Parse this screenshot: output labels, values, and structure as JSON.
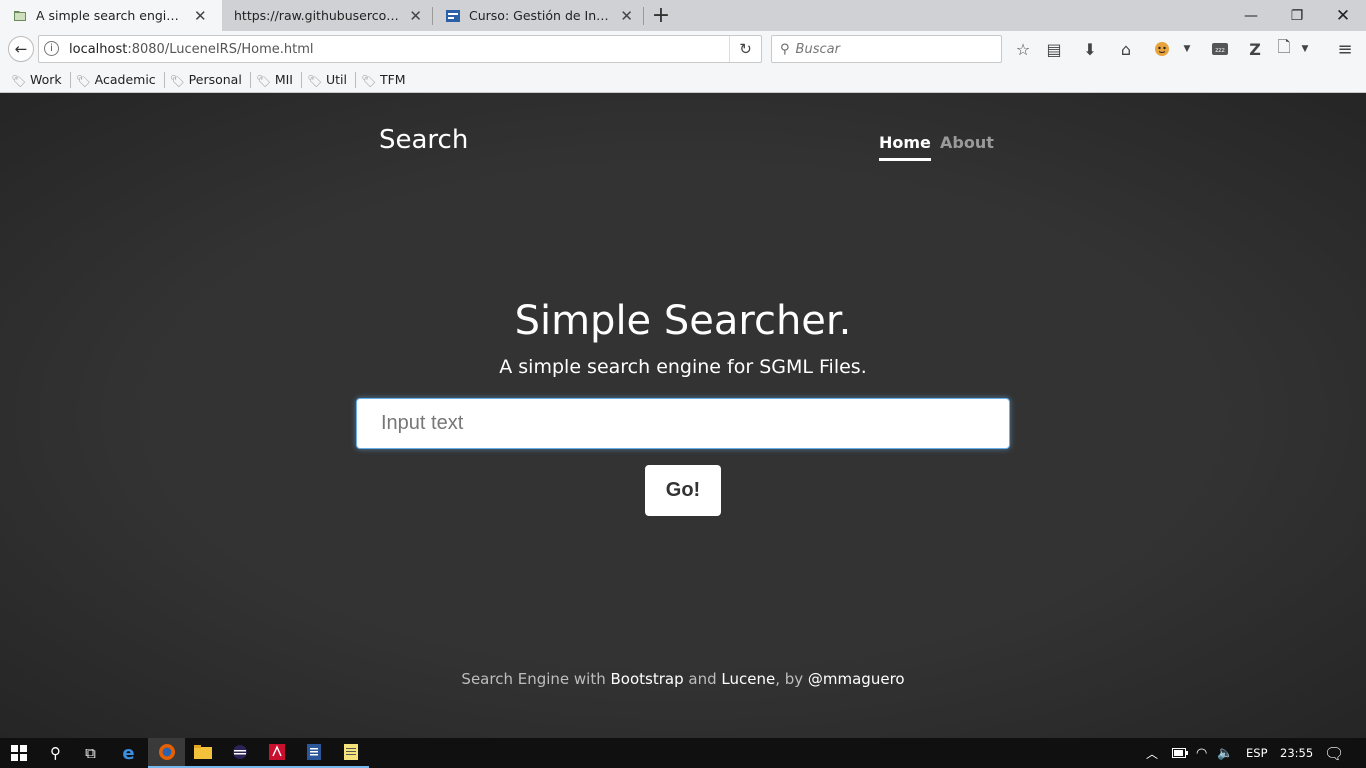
{
  "browser": {
    "tabs": [
      {
        "title": "A simple search engine with",
        "icon": "book-icon"
      },
      {
        "title": "https://raw.githubusercontent.c",
        "icon": ""
      },
      {
        "title": "Curso: Gestión de Informaci",
        "icon": "moodle-icon"
      }
    ],
    "url_host": "localhost",
    "url_rest": ":8080/LuceneIRS/Home.html",
    "search_placeholder": "Buscar",
    "bookmarks": [
      "Work",
      "Academic",
      "Personal",
      "MII",
      "Util",
      "TFM"
    ]
  },
  "site": {
    "brand": "Search",
    "nav": {
      "home": "Home",
      "about": "About"
    },
    "heading": "Simple Searcher.",
    "subheading": "A simple search engine for SGML Files.",
    "input_placeholder": "Input text",
    "button": "Go!",
    "footer": {
      "prefix": "Search Engine with ",
      "bootstrap": "Bootstrap",
      "and": " and ",
      "lucene": "Lucene",
      "by": ", by ",
      "author": "@mmaguero"
    }
  },
  "taskbar": {
    "language": "ESP",
    "time": "23:55"
  },
  "colors": {
    "page_bg": "#333333",
    "input_focus": "#66afe9"
  }
}
